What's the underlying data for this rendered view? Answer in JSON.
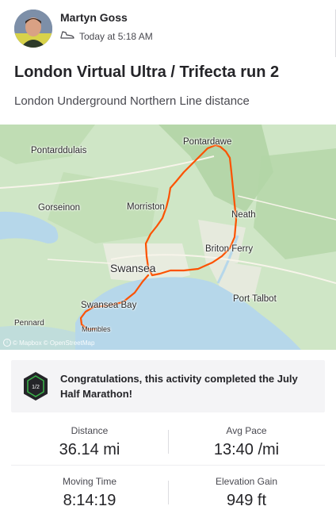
{
  "athlete": {
    "name": "Martyn Goss",
    "timestamp": "Today at 5:18 AM",
    "activity_icon": "run-shoe-icon"
  },
  "activity": {
    "title": "London Virtual Ultra / Trifecta run 2",
    "description": "London Underground Northern Line distance"
  },
  "map": {
    "places": {
      "pontardawe": "Pontardawe",
      "pontarddulais": "Pontarddulais",
      "gorseinon": "Gorseinon",
      "morriston": "Morriston",
      "neath": "Neath",
      "briton_ferry": "Briton Ferry",
      "swansea": "Swansea",
      "port_talbot": "Port Talbot",
      "swansea_bay": "Swansea Bay",
      "pennard": "Pennard",
      "mumbles": "Mumbles"
    },
    "attribution": "© Mapbox © OpenStreetMap",
    "route_color": "#fc5200",
    "water_color": "#b6d7ea",
    "land_color": "#cfe6c6"
  },
  "achievement": {
    "text": "Congratulations, this activity completed the July Half Marathon!",
    "badge_text": "1/2",
    "badge_icon": "challenge-badge-icon"
  },
  "stats": [
    {
      "label": "Distance",
      "value": "36.14 mi"
    },
    {
      "label": "Avg Pace",
      "value": "13:40 /mi"
    },
    {
      "label": "Moving Time",
      "value": "8:14:19"
    },
    {
      "label": "Elevation Gain",
      "value": "949 ft"
    }
  ]
}
